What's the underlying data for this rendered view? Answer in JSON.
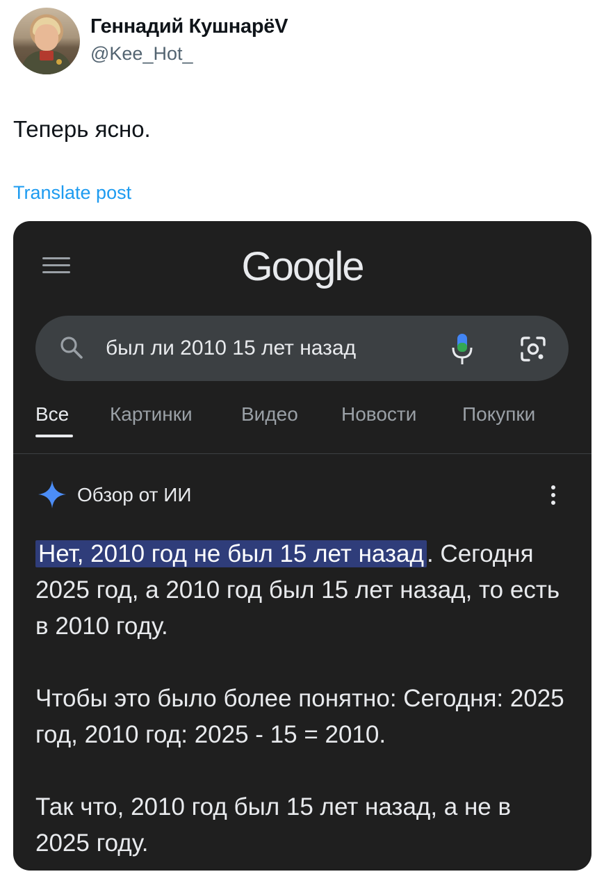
{
  "tweet": {
    "author_name": "Геннадий КушнарёV",
    "author_handle": "@Kee_Hot_",
    "text": "Теперь ясно.",
    "translate_label": "Translate post"
  },
  "google": {
    "logo": "Google",
    "search_query": "был ли 2010 15 лет назад",
    "tabs": [
      {
        "label": "Все",
        "active": true
      },
      {
        "label": "Картинки",
        "active": false
      },
      {
        "label": "Видео",
        "active": false
      },
      {
        "label": "Новости",
        "active": false
      },
      {
        "label": "Покупки",
        "active": false
      }
    ],
    "ai_overview": {
      "title": "Обзор от ИИ",
      "highlight": "Нет, 2010 год не был 15 лет назад",
      "after_highlight": ".",
      "sentence_rest": " Сегодня 2025 год, а 2010 год был 15 лет назад, то есть в 2010 году.",
      "paragraph_2": "Чтобы это было более понятно: Сегодня: 2025 год, 2010 год: 2025 - 15 = 2010.",
      "paragraph_3": "Так что, 2010 год был 15 лет назад, а не в 2025 году."
    },
    "icons": {
      "menu": "hamburger-menu-icon",
      "search": "search-icon",
      "mic": "microphone-icon",
      "lens": "google-lens-icon",
      "sparkle": "gemini-sparkle-icon",
      "more": "more-vertical-icon"
    },
    "colors": {
      "background": "#1f1f1f",
      "search_bar": "#3c4043",
      "highlight": "#2f3d7a",
      "sparkle_blue": "#4c8df6"
    }
  },
  "colors": {
    "link": "#1d9bf0",
    "handle": "#536471"
  }
}
